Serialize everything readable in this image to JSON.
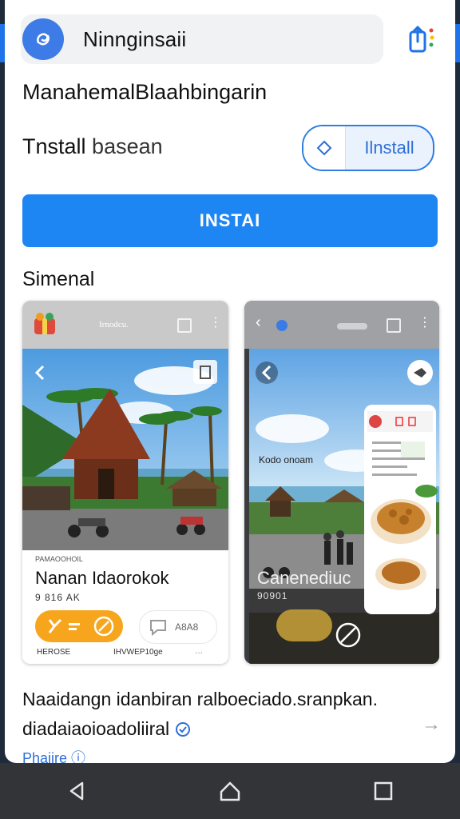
{
  "browser": {
    "url_text": "Ninnginsaii"
  },
  "app": {
    "name": "ManahemalBlaahbingarin",
    "install_label": "Tnstall",
    "install_sub": "basean",
    "outline_install_label": "Ilnstall",
    "primary_install_label": "INSTAI"
  },
  "section": {
    "title": "Simenal"
  },
  "cards": [
    {
      "header_title": "Irnodcu.",
      "small_label": "PAMAOOHOIL",
      "name": "Nanan Idaorokok",
      "meta": "9 816 AK",
      "ghost_text": "A8A8",
      "footer_left": "HEROSE",
      "footer_mid": "IHVWEP10ge",
      "footer_right": "..."
    },
    {
      "caption": "Kodo onoam",
      "name": "Canenediuc",
      "meta": "90901"
    }
  ],
  "promo": {
    "line1": "Naaidangn idanbiran ralboeciado.sranpkan.",
    "line2": "diadaiaoioadoliiral",
    "more_link": "Phaiire"
  },
  "colors": {
    "accent": "#1d86f3",
    "orange": "#f6a51d",
    "navbar": "#333438"
  }
}
